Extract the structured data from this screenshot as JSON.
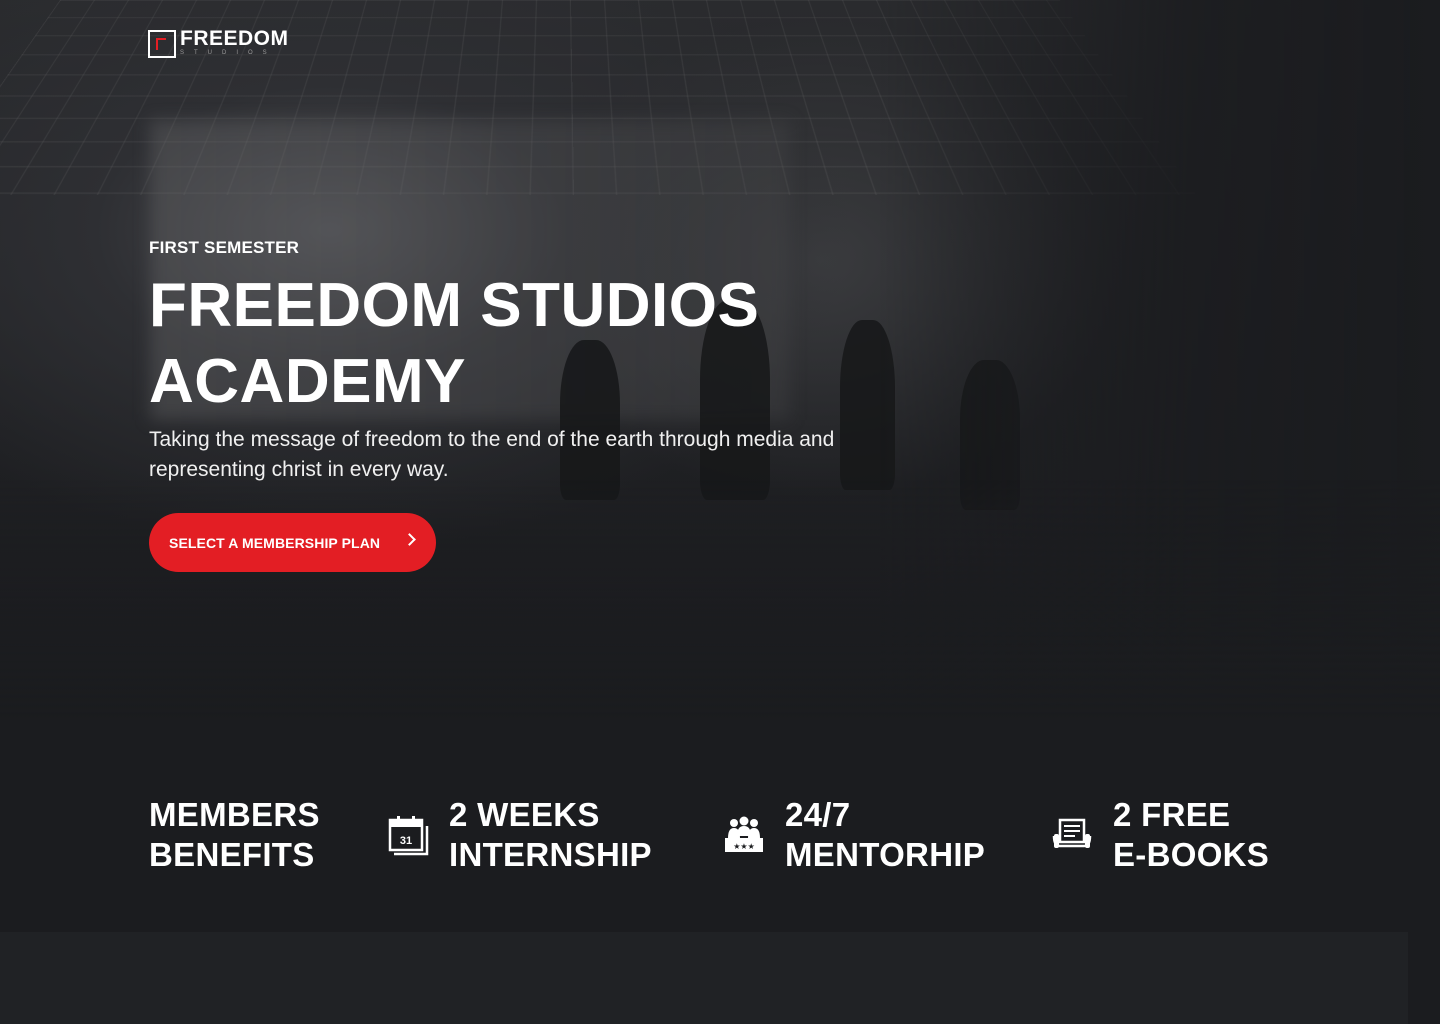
{
  "brand": {
    "name": "FREEDOM",
    "sub": "STUDIOS",
    "accent_color": "#e31e24"
  },
  "hero": {
    "eyebrow": "FIRST SEMESTER",
    "title_line1": "FREEDOM STUDIOS",
    "title_line2": "ACADEMY",
    "subtitle": "Taking the message of freedom to the end of the earth through media and representing christ in every way.",
    "cta_label": "SELECT A MEMBERSHIP PLAN",
    "cta_icon": "chevron-right-icon"
  },
  "benefits": {
    "heading_line1": "MEMBERS",
    "heading_line2": "BENEFITS",
    "items": [
      {
        "icon": "calendar-icon",
        "calendar_day": "31",
        "line1": "2 WEEKS",
        "line2": "INTERNSHIP"
      },
      {
        "icon": "group-icon",
        "line1": "24/7",
        "line2": "MENTORHIP"
      },
      {
        "icon": "ebook-icon",
        "line1": "2 FREE",
        "line2": "E-BOOKS"
      }
    ]
  }
}
